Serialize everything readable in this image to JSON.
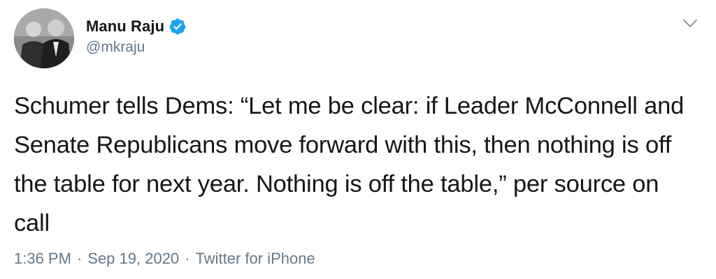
{
  "author": {
    "name": "Manu Raju",
    "handle": "@mkraju",
    "verified": true
  },
  "tweet": {
    "text": "Schumer tells Dems: “Let me be clear: if Leader McConnell and Senate Republicans move forward with this, then nothing is off the table for next year. Nothing is off the table,” per source on call"
  },
  "meta": {
    "time": "1:36 PM",
    "separator": "·",
    "date": "Sep 19, 2020",
    "source": "Twitter for iPhone"
  },
  "colors": {
    "verified_badge": "#1da1f2",
    "secondary_text": "#657786",
    "primary_text": "#14171a"
  },
  "icons": {
    "verified": "verified-badge-icon",
    "more": "chevron-down-icon"
  }
}
